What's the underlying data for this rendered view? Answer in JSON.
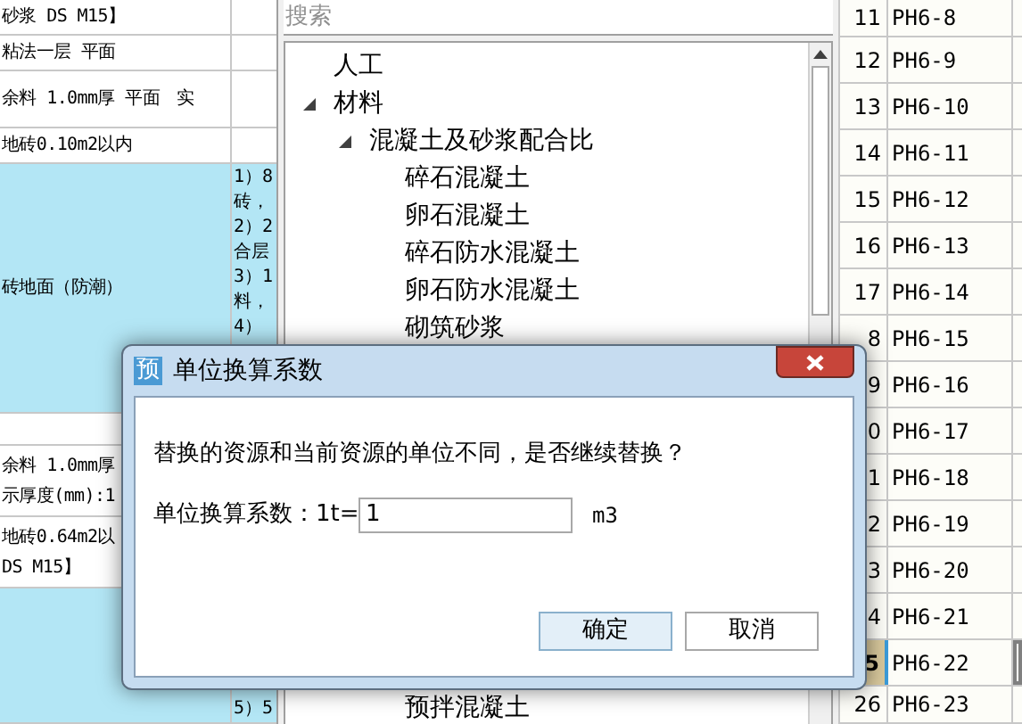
{
  "left_table": {
    "rows": [
      {
        "lines": [
          "砂浆 DS M15】"
        ],
        "selected": false
      },
      {
        "lines": [
          "粘法一层 平面"
        ],
        "selected": false
      },
      {
        "lines": [
          "余料 1.0mm厚 平面　实"
        ],
        "selected": false
      },
      {
        "lines": [
          "地砖0.10m2以内"
        ],
        "selected": false
      },
      {
        "lines": [
          "砖地面（防潮）"
        ],
        "detail": [
          "1）8",
          "砖，",
          "2）2",
          "合层",
          "3）1",
          "料，",
          "4）"
        ],
        "selected": true
      },
      {
        "selected": false
      },
      {
        "lines": [
          "余料 1.0mm厚",
          "示厚度(mm):1"
        ],
        "selected": false
      },
      {
        "lines": [
          "地砖0.64m2以",
          "DS M15】"
        ],
        "selected": false
      },
      {
        "detail": [
          "5）5"
        ],
        "selected": true
      }
    ]
  },
  "resource_panel": {
    "search": {
      "placeholder": "搜索"
    },
    "tree": [
      {
        "label": "人工"
      },
      {
        "label": "材料",
        "expanded": true,
        "children": [
          {
            "label": "混凝土及砂浆配合比",
            "expanded": true,
            "children": [
              {
                "label": "碎石混凝土"
              },
              {
                "label": "卵石混凝土"
              },
              {
                "label": "碎石防水混凝土"
              },
              {
                "label": "卵石防水混凝土"
              },
              {
                "label": "砌筑砂浆"
              },
              {
                "label": "预拌混凝土"
              }
            ]
          }
        ]
      }
    ]
  },
  "right_table": {
    "rows": [
      {
        "number": "11",
        "code": "PH6-8",
        "selected": false
      },
      {
        "number": "12",
        "code": "PH6-9",
        "selected": false
      },
      {
        "number": "13",
        "code": "PH6-10",
        "selected": false
      },
      {
        "number": "14",
        "code": "PH6-11",
        "selected": false
      },
      {
        "number": "15",
        "code": "PH6-12",
        "selected": false
      },
      {
        "number": "16",
        "code": "PH6-13",
        "selected": false
      },
      {
        "number": "17",
        "code": "PH6-14",
        "selected": false
      },
      {
        "number": "8",
        "code": "PH6-15",
        "selected": false
      },
      {
        "number": "9",
        "code": "PH6-16",
        "selected": false
      },
      {
        "number": "0",
        "code": "PH6-17",
        "selected": false
      },
      {
        "number": "1",
        "code": "PH6-18",
        "selected": false
      },
      {
        "number": "2",
        "code": "PH6-19",
        "selected": false
      },
      {
        "number": "3",
        "code": "PH6-20",
        "selected": false
      },
      {
        "number": "4",
        "code": "PH6-21",
        "selected": false
      },
      {
        "number": "5",
        "code": "PH6-22",
        "selected": true
      },
      {
        "number": "26",
        "code": "PH6-23",
        "selected": false
      }
    ]
  },
  "dialog": {
    "icon_text": "预",
    "title": "单位换算系数",
    "message": "替换的资源和当前资源的单位不同，是否继续替换？",
    "factor_label": "单位换算系数：1t=",
    "factor_value": "1",
    "unit": "m3",
    "buttons": [
      {
        "label": "确定",
        "default": true
      },
      {
        "label": "取消",
        "default": false
      }
    ]
  }
}
